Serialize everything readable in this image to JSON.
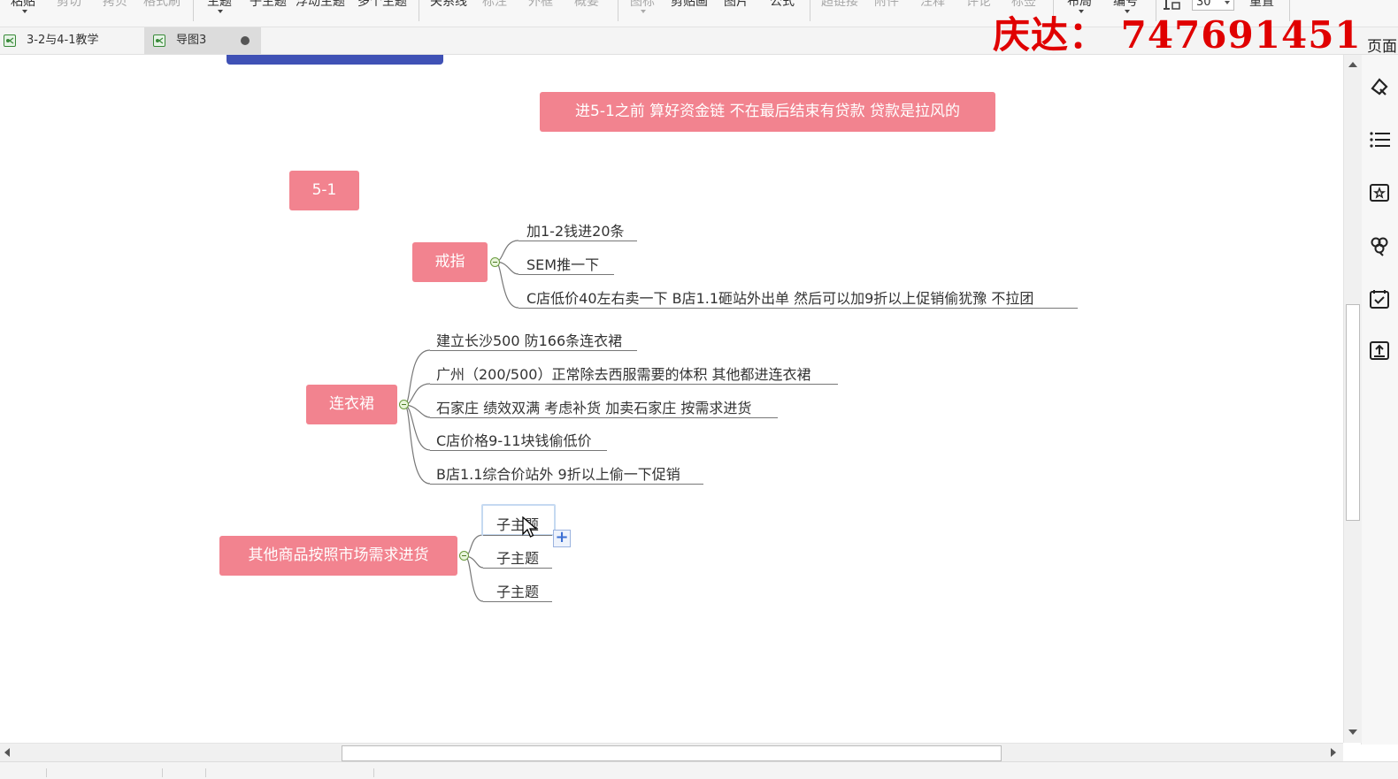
{
  "toolbar": {
    "items": [
      {
        "label": "粘贴",
        "dim": false
      },
      {
        "label": "剪切",
        "dim": true
      },
      {
        "label": "拷贝",
        "dim": true
      },
      {
        "label": "格式刷",
        "dim": true
      },
      {
        "label": "主题",
        "dim": false
      },
      {
        "label": "子主题",
        "dim": false
      },
      {
        "label": "浮动主题",
        "dim": false
      },
      {
        "label": "多个主题",
        "dim": false
      },
      {
        "label": "关系线",
        "dim": false
      },
      {
        "label": "标注",
        "dim": true
      },
      {
        "label": "外框",
        "dim": true
      },
      {
        "label": "概要",
        "dim": true
      },
      {
        "label": "图标",
        "dim": true
      },
      {
        "label": "剪贴画",
        "dim": false
      },
      {
        "label": "图片",
        "dim": false
      },
      {
        "label": "公式",
        "dim": false
      },
      {
        "label": "超链接",
        "dim": true
      },
      {
        "label": "附件",
        "dim": true
      },
      {
        "label": "注释",
        "dim": true
      },
      {
        "label": "评论",
        "dim": true
      },
      {
        "label": "标签",
        "dim": true
      },
      {
        "label": "布局",
        "dim": false
      },
      {
        "label": "编号",
        "dim": false
      },
      {
        "label": "重置",
        "dim": false
      }
    ],
    "zoom_value": "30"
  },
  "tabs": [
    {
      "label": "3-2与4-1教学",
      "active": false
    },
    {
      "label": "导图3",
      "active": true,
      "unsaved": true
    }
  ],
  "watermark": "庆达：  747691451",
  "right_panel": {
    "title": "页面",
    "icons": [
      "format-icon",
      "outline-icon",
      "theme-icon",
      "clipart-icon",
      "task-icon",
      "export-icon"
    ]
  },
  "mindmap": {
    "top_note": "进5-1之前 算好资金链  不在最后结束有贷款  贷款是拉风的",
    "node_51": "5-1",
    "ring": {
      "label": "戒指",
      "children": [
        "加1-2钱进20条",
        "SEM推一下",
        "C店低价40左右卖一下   B店1.1砸站外出单  然后可以加9折以上促销偷犹豫 不拉团"
      ]
    },
    "dress": {
      "label": "连衣裙",
      "children": [
        "建立长沙500 防166条连衣裙",
        "广州（200/500）正常除去西服需要的体积 其他都进连衣裙",
        "石家庄 绩效双满 考虑补货 加卖石家庄 按需求进货",
        "C店价格9-11块钱偷低价",
        "B店1.1综合价站外  9折以上偷一下促销"
      ]
    },
    "other": {
      "label": "其他商品按照市场需求进货",
      "children": [
        "子主题",
        "子主题",
        "子主题"
      ]
    }
  },
  "colors": {
    "node_fill": "#f2838f",
    "top_node": "#3f51b5",
    "watermark": "#e00000",
    "selection": "#c5d9f1"
  }
}
